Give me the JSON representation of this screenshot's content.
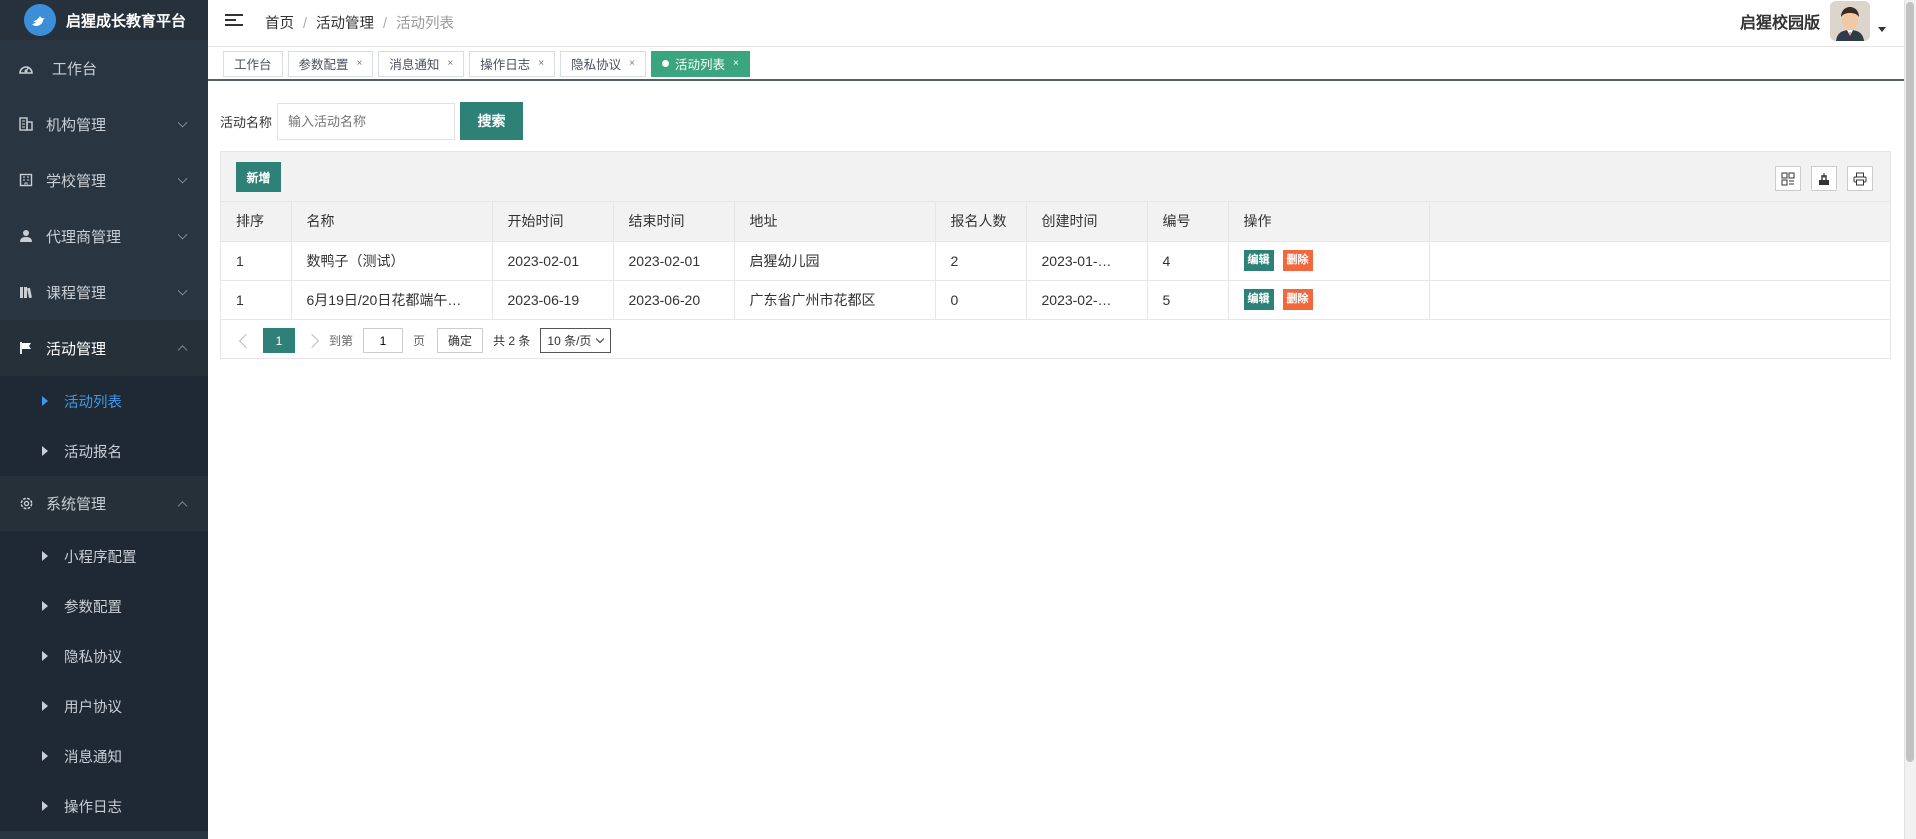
{
  "app": {
    "title": "启猩成长教育平台"
  },
  "sidebar": {
    "items": [
      {
        "label": "工作台",
        "icon": "dashboard-icon"
      },
      {
        "label": "机构管理",
        "icon": "building-icon"
      },
      {
        "label": "学校管理",
        "icon": "school-icon"
      },
      {
        "label": "代理商管理",
        "icon": "user-icon"
      },
      {
        "label": "课程管理",
        "icon": "books-icon"
      },
      {
        "label": "活动管理",
        "icon": "flag-icon"
      }
    ],
    "activity_sub": [
      {
        "label": "活动列表"
      },
      {
        "label": "活动报名"
      }
    ],
    "system": {
      "label": "系统管理",
      "icon": "gear-icon"
    },
    "system_sub": [
      {
        "label": "小程序配置"
      },
      {
        "label": "参数配置"
      },
      {
        "label": "隐私协议"
      },
      {
        "label": "用户协议"
      },
      {
        "label": "消息通知"
      },
      {
        "label": "操作日志"
      }
    ]
  },
  "header": {
    "breadcrumb": [
      "首页",
      "活动管理",
      "活动列表"
    ],
    "user_name": "启猩校园版"
  },
  "tabs": [
    {
      "label": "工作台",
      "closable": false
    },
    {
      "label": "参数配置",
      "closable": true
    },
    {
      "label": "消息通知",
      "closable": true
    },
    {
      "label": "操作日志",
      "closable": true
    },
    {
      "label": "隐私协议",
      "closable": true
    },
    {
      "label": "活动列表",
      "closable": true,
      "active": true
    }
  ],
  "search": {
    "label": "活动名称",
    "placeholder": "输入活动名称",
    "button": "搜索"
  },
  "toolbar": {
    "add_label": "新增"
  },
  "table": {
    "columns": [
      "排序",
      "名称",
      "开始时间",
      "结束时间",
      "地址",
      "报名人数",
      "创建时间",
      "编号",
      "操作"
    ],
    "rows": [
      {
        "sort": "1",
        "name": "数鸭子（测试）",
        "start": "2023-02-01",
        "end": "2023-02-01",
        "address": "启猩幼儿园",
        "count": "2",
        "created": "2023-01-…",
        "id": "4"
      },
      {
        "sort": "1",
        "name": "6月19日/20日花都端午…",
        "start": "2023-06-19",
        "end": "2023-06-20",
        "address": "广东省广州市花都区",
        "count": "0",
        "created": "2023-02-…",
        "id": "5"
      }
    ],
    "edit_label": "编辑",
    "delete_label": "删除"
  },
  "pager": {
    "current": "1",
    "goto_label": "到第",
    "page_value": "1",
    "page_unit": "页",
    "ok_label": "确定",
    "total": "共 2 条",
    "page_size": "10 条/页"
  },
  "colors": {
    "primary": "#2d8177",
    "danger": "#f0683b",
    "sidebar": "#2a3542",
    "active_tab": "#3aa57e"
  }
}
